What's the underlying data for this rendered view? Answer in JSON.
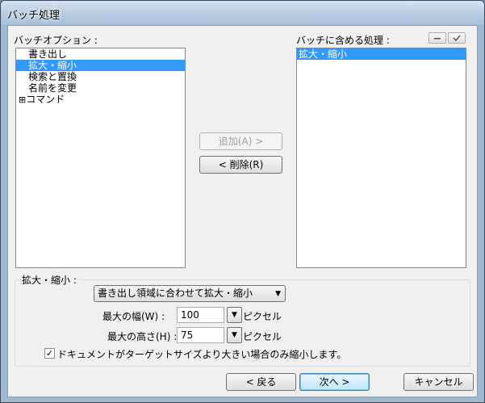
{
  "window": {
    "title": "バッチ処理"
  },
  "options": {
    "label": "バッチオプション :",
    "items": [
      {
        "text": "書き出し",
        "selected": false
      },
      {
        "text": "拡大・縮小",
        "selected": true
      },
      {
        "text": "検索と置換",
        "selected": false
      },
      {
        "text": "名前を変更",
        "selected": false
      },
      {
        "text": "コマンド",
        "selected": false,
        "expander": "⊞"
      }
    ]
  },
  "included": {
    "label": "バッチに含める処理 :",
    "items": [
      {
        "text": "拡大・縮小",
        "selected": true
      }
    ]
  },
  "buttons": {
    "add": "追加(A) >",
    "remove": "< 削除(R)",
    "back": "< 戻る",
    "next": "次へ >",
    "cancel": "キャンセル"
  },
  "scale": {
    "caption": "拡大・縮小 :",
    "mode": "書き出し領域に合わせて拡大・縮小",
    "width_label": "最大の幅(W) :",
    "width_value": "100",
    "height_label": "最大の高さ(H) :",
    "height_value": "75",
    "unit": "ピクセル",
    "shrink_only_label": "ドキュメントがターゲットサイズより大きい場合のみ縮小します。",
    "shrink_only_checked": true
  },
  "icons": {
    "expander": "plus-box-icon",
    "dropdown": "triangle-down-icon",
    "check": "checkmark-icon"
  }
}
